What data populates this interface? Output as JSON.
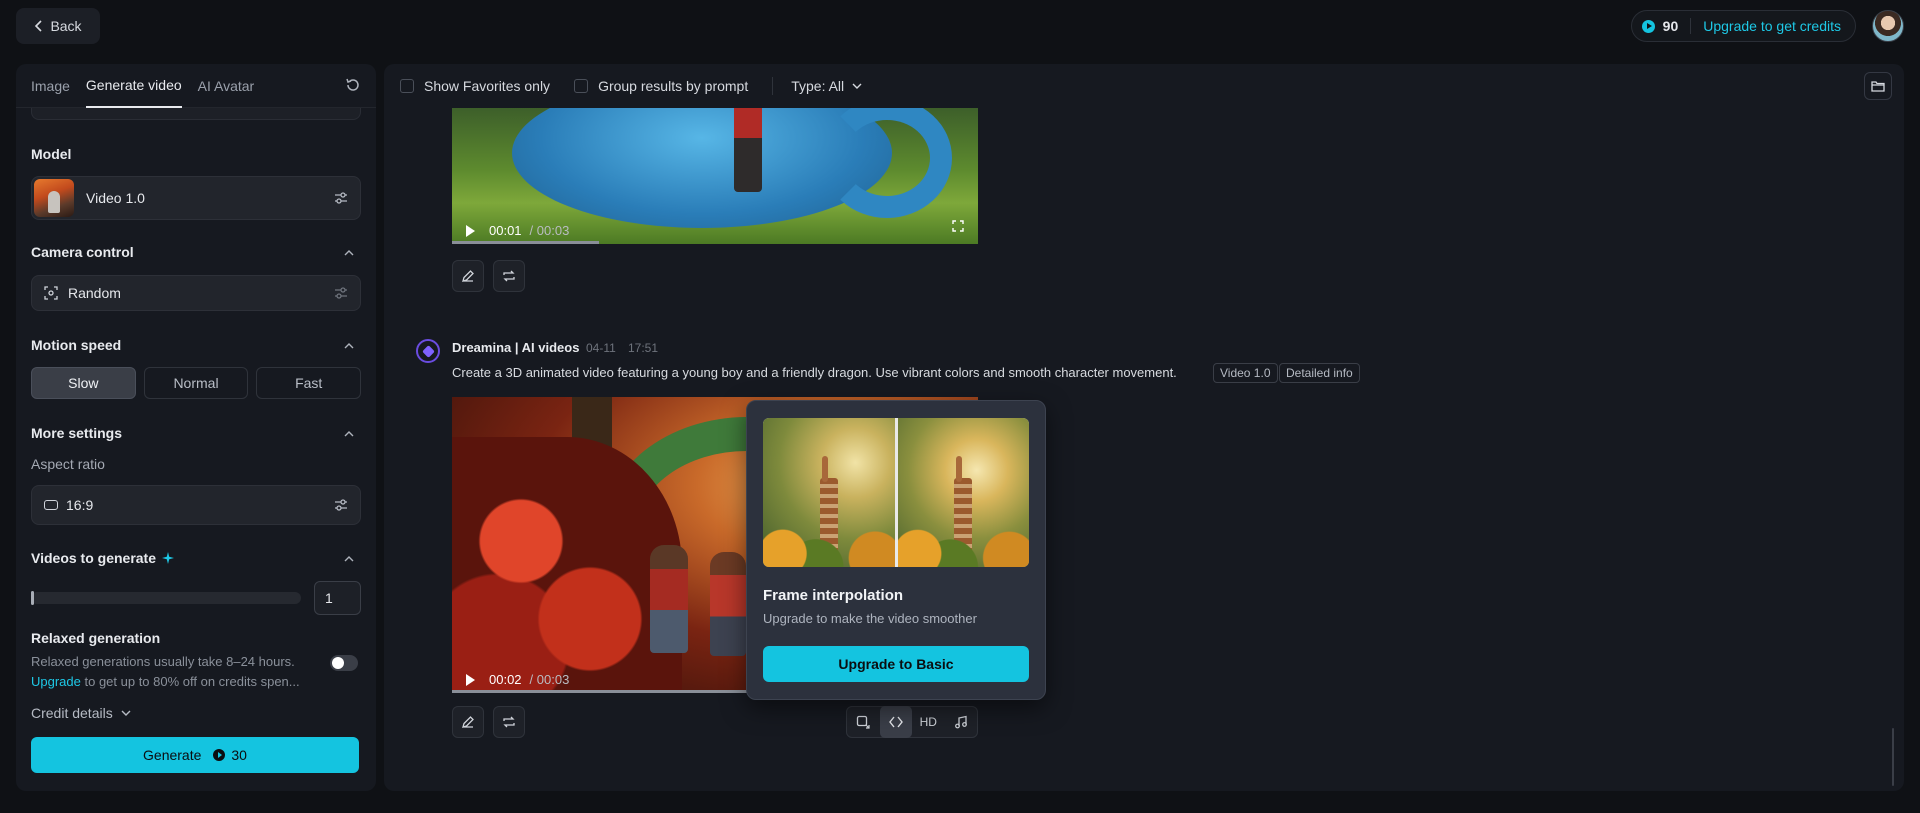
{
  "topbar": {
    "back_label": "Back",
    "credits": "90",
    "upgrade_label": "Upgrade to get credits"
  },
  "left_panel": {
    "tabs": [
      {
        "label": "Image"
      },
      {
        "label": "Generate video"
      },
      {
        "label": "AI Avatar"
      }
    ],
    "model": {
      "heading": "Model",
      "value": "Video 1.0"
    },
    "camera": {
      "heading": "Camera control",
      "value": "Random"
    },
    "motion": {
      "heading": "Motion speed",
      "options": [
        "Slow",
        "Normal",
        "Fast"
      ],
      "selected": "Slow"
    },
    "more_settings": {
      "heading": "More settings",
      "aspect_label": "Aspect ratio",
      "aspect_value": "16:9"
    },
    "videos": {
      "heading": "Videos to generate",
      "count": "1"
    },
    "relaxed": {
      "heading": "Relaxed generation",
      "desc_line1": "Relaxed generations usually take 8–24 hours.",
      "upgrade_link": "Upgrade",
      "desc_line2": " to get up to 80% off on credits spen..."
    },
    "credit_details": "Credit details",
    "generate": {
      "label": "Generate",
      "cost": "30"
    }
  },
  "main": {
    "filters": {
      "favorites": "Show Favorites only",
      "group": "Group results by prompt",
      "type": "Type: All"
    },
    "video1": {
      "current": "00:01",
      "duration": " / 00:03",
      "progress": 0.28
    },
    "entry": {
      "author": "Dreamina | AI videos",
      "date": "04-11",
      "time": "17:51",
      "prompt": "Create a 3D animated video featuring a young boy and a friendly dragon. Use vibrant colors and smooth character movement.",
      "tags": [
        "Video 1.0",
        "Detailed info"
      ]
    },
    "video2": {
      "current": "00:02",
      "duration": " / 00:03",
      "progress": 0.57
    },
    "toolbar": {
      "hd_label": "HD"
    }
  },
  "popover": {
    "title": "Frame interpolation",
    "desc": "Upgrade to make the video smoother",
    "button": "Upgrade to Basic"
  },
  "colors": {
    "accent": "#14c4e0",
    "panel": "#161920",
    "background": "#0f1115"
  }
}
